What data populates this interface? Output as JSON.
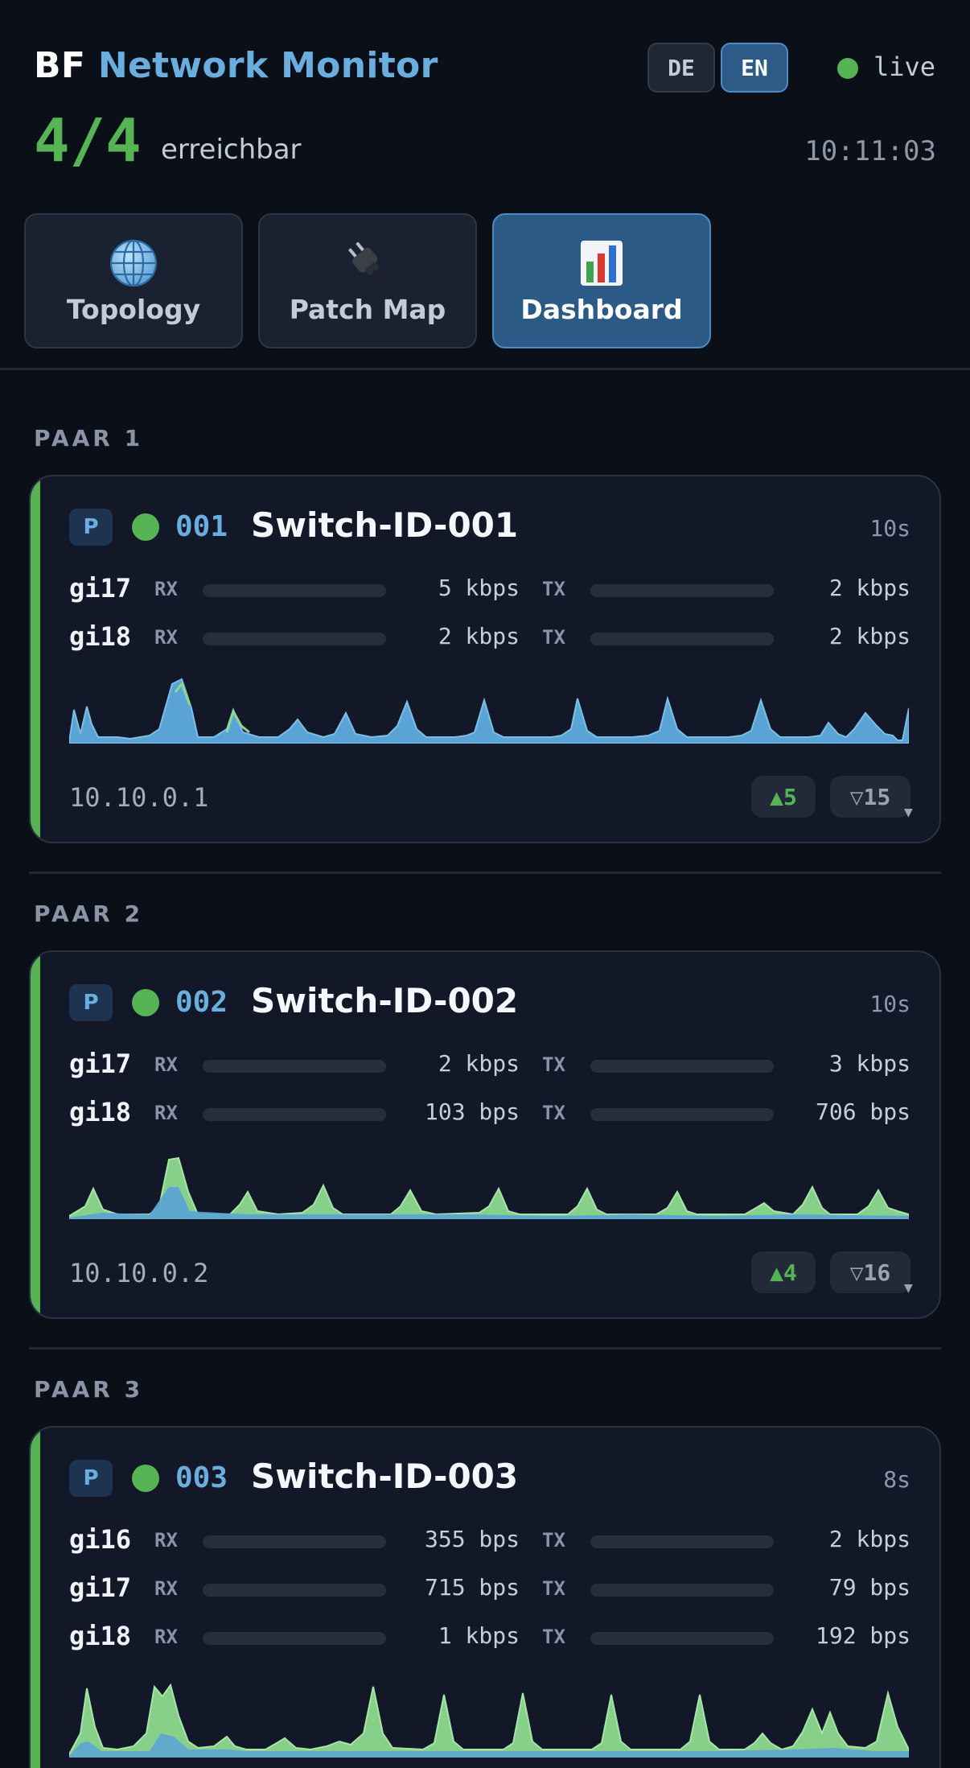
{
  "header": {
    "title_prefix": "BF",
    "title_accent": "Network Monitor",
    "languages": [
      "DE",
      "EN"
    ],
    "active_language": "EN",
    "live_label": "live",
    "reachable_count": "4/4",
    "reachable_label": "erreichbar",
    "time": "10:11:03"
  },
  "tabs": [
    {
      "label": "Topology",
      "icon": "globe-icon",
      "active": false
    },
    {
      "label": "Patch Map",
      "icon": "plug-icon",
      "active": false
    },
    {
      "label": "Dashboard",
      "icon": "bar-chart-icon",
      "active": true
    }
  ],
  "colors": {
    "accent": "#6aaee0",
    "ok": "#56b455",
    "rx_series": "#6ab0de",
    "tx_series": "#8fd68f"
  },
  "pairs": [
    {
      "label": "PAAR 1",
      "device": {
        "badge": "P",
        "id": "001",
        "name": "Switch-ID-001",
        "age": "10s",
        "ip": "10.10.0.1",
        "up": "▲5",
        "down": "▽15",
        "ports": [
          {
            "name": "gi17",
            "rx_label": "RX",
            "rx": "5 kbps",
            "tx_label": "TX",
            "tx": "2 kbps"
          },
          {
            "name": "gi18",
            "rx_label": "RX",
            "rx": "2 kbps",
            "tx_label": "TX",
            "tx": "2 kbps"
          }
        ]
      }
    },
    {
      "label": "PAAR 2",
      "device": {
        "badge": "P",
        "id": "002",
        "name": "Switch-ID-002",
        "age": "10s",
        "ip": "10.10.0.2",
        "up": "▲4",
        "down": "▽16",
        "ports": [
          {
            "name": "gi17",
            "rx_label": "RX",
            "rx": "2 kbps",
            "tx_label": "TX",
            "tx": "3 kbps"
          },
          {
            "name": "gi18",
            "rx_label": "RX",
            "rx": "103 bps",
            "tx_label": "TX",
            "tx": "706 bps"
          }
        ]
      }
    },
    {
      "label": "PAAR 3",
      "device": {
        "badge": "P",
        "id": "003",
        "name": "Switch-ID-003",
        "age": "8s",
        "ports": [
          {
            "name": "gi16",
            "rx_label": "RX",
            "rx": "355 bps",
            "tx_label": "TX",
            "tx": "2 kbps"
          },
          {
            "name": "gi17",
            "rx_label": "RX",
            "rx": "715 bps",
            "tx_label": "TX",
            "tx": "79 bps"
          },
          {
            "name": "gi18",
            "rx_label": "RX",
            "rx": "1 kbps",
            "tx_label": "TX",
            "tx": "192 bps"
          }
        ]
      }
    }
  ]
}
